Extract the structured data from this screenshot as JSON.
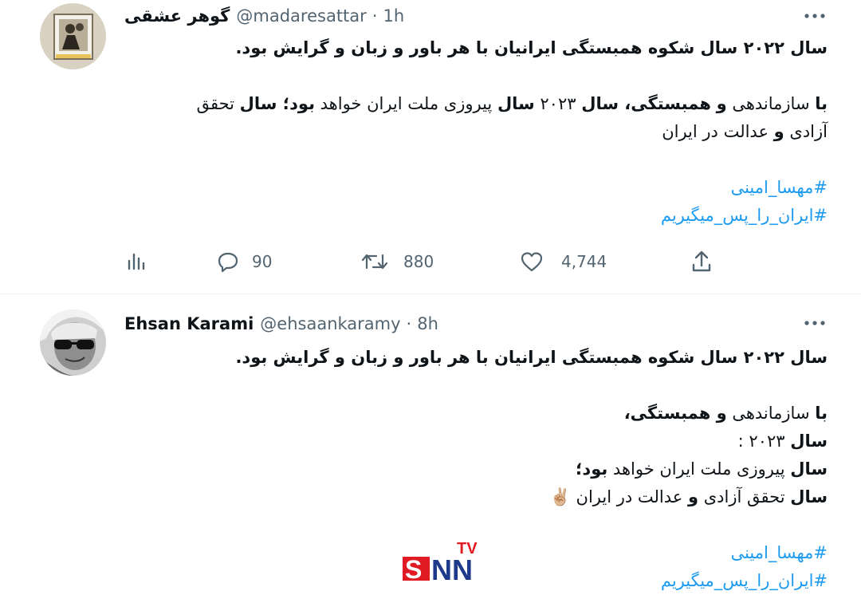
{
  "tweets": [
    {
      "author_name": "گوهر عشقی",
      "handle": "@madaresattar",
      "time": "1h",
      "headline": "سال ۲۰۲۲ سال شکوه همبستگی ایرانیان با هر باور و زبان و گرایش بود.",
      "para_a": {
        "w1": "با",
        "w2": " سازماندهی ",
        "w3": "و",
        "w4": " ",
        "w5": "همبستگی، سال",
        "w6": " ۲۰۲۳ ",
        "w7": "سال",
        "w8": " پیروزی ملت ایران خواهد ",
        "w9": "بود؛ سال",
        "w10": " تحقق"
      },
      "para_b": {
        "w1": "آزادی ",
        "w2": "و",
        "w3": " عدالت در ایران"
      },
      "hashtags": [
        "#مهسا_امینی",
        "#ایران_را_پس_میگیریم"
      ],
      "replies": "90",
      "retweets": "880",
      "likes": "4,744"
    },
    {
      "author_name": "Ehsan Karami",
      "handle": "@ehsaankaramy",
      "time": "8h",
      "headline": "سال ۲۰۲۲ سال شکوه همبستگی ایرانیان با هر باور و زبان و گرایش بود.",
      "l1": {
        "w1": "با",
        "w2": " سازماندهی ",
        "w3": "و همبستگی،"
      },
      "l2": {
        "w1": "سال",
        "w2": " ۲۰۲۳ :"
      },
      "l3": {
        "w1": "سال",
        "w2": " پیروزی ملت ایران خواهد ",
        "w3": "بود؛"
      },
      "l4": {
        "w1": "سال",
        "w2": " تحقق آزادی ",
        "w3": "و",
        "w4": " عدالت در ایران ",
        "emoji": "✌🏼"
      },
      "hashtags": [
        "#مهسا_امینی",
        "#ایران_را_پس_میگیریم"
      ]
    }
  ],
  "watermark": {
    "main": "SNN",
    "sup": "TV"
  },
  "icons": {
    "more": "more-horizontal-icon",
    "analytics": "analytics-icon",
    "reply": "reply-icon",
    "retweet": "retweet-icon",
    "like": "like-icon",
    "share": "share-icon"
  },
  "colors": {
    "link": "#1d9bf0",
    "muted": "#536471",
    "text": "#0f1419",
    "watermark_red": "#e01b24",
    "watermark_blue": "#1f3a8a"
  }
}
